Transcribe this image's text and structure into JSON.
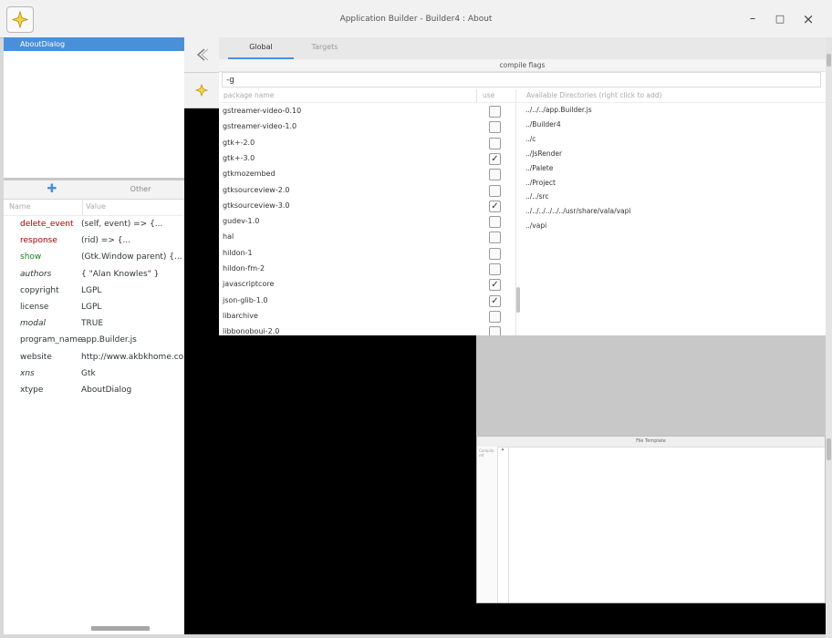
{
  "window": {
    "title": "Application Builder - Builder4 : About",
    "minimize_glyph": "–",
    "maximize_glyph": "□",
    "close_glyph": "×"
  },
  "tree": {
    "selected": "AboutDialog"
  },
  "left_tabs": {
    "other": "Other"
  },
  "props": {
    "headers": {
      "name": "Name",
      "value": "Value"
    },
    "rows": [
      {
        "name": "delete_event",
        "value": "(self, event) => {...",
        "kind": "event"
      },
      {
        "name": "response",
        "value": "(rid) => {...",
        "kind": "event"
      },
      {
        "name": "show",
        "value": "(Gtk.Window parent) {...",
        "kind": "show"
      },
      {
        "name": "authors",
        "value": "{ \"Alan Knowles\" }",
        "kind": "italic"
      },
      {
        "name": "copyright",
        "value": "LGPL",
        "kind": "plain"
      },
      {
        "name": "license",
        "value": "LGPL",
        "kind": "plain"
      },
      {
        "name": "modal",
        "value": "TRUE",
        "kind": "italic"
      },
      {
        "name": "program_name",
        "value": "app.Builder.js",
        "kind": "plain"
      },
      {
        "name": "website",
        "value": "http://www.akbkhome.com",
        "kind": "plain"
      },
      {
        "name": "xns",
        "value": "Gtk",
        "kind": "italic"
      },
      {
        "name": "xtype",
        "value": "AboutDialog",
        "kind": "plain"
      }
    ]
  },
  "tabs": {
    "global": "Global",
    "targets": "Targets"
  },
  "compile": {
    "label": "compile flags",
    "value": "-g"
  },
  "packages": {
    "headers": {
      "name": "package name",
      "use": "use"
    },
    "rows": [
      {
        "name": "gstreamer-video-0.10",
        "checked": false
      },
      {
        "name": "gstreamer-video-1.0",
        "checked": false
      },
      {
        "name": "gtk+-2.0",
        "checked": false
      },
      {
        "name": "gtk+-3.0",
        "checked": true
      },
      {
        "name": "gtkmozembed",
        "checked": false
      },
      {
        "name": "gtksourceview-2.0",
        "checked": false
      },
      {
        "name": "gtksourceview-3.0",
        "checked": true
      },
      {
        "name": "gudev-1.0",
        "checked": false
      },
      {
        "name": "hal",
        "checked": false
      },
      {
        "name": "hildon-1",
        "checked": false
      },
      {
        "name": "hildon-fm-2",
        "checked": false
      },
      {
        "name": "javascriptcore",
        "checked": true
      },
      {
        "name": "json-glib-1.0",
        "checked": true
      },
      {
        "name": "libarchive",
        "checked": false
      },
      {
        "name": "libbonoboui-2.0",
        "checked": false
      }
    ]
  },
  "directories": {
    "header": "Available Directories (right click to add)",
    "items": [
      "../../../app.Builder.js",
      "../Builder4",
      "../c",
      "../JsRender",
      "../Palete",
      "../Project",
      "../../src",
      "../../../../../../usr/share/vala/vapi",
      "../vapi"
    ]
  },
  "preview": {
    "title": "File Template",
    "left_label": "Compile ret"
  },
  "icons": {
    "app": "sparkle-icon",
    "back": "back-arrow-icon",
    "add": "plus-icon",
    "check": "✓"
  }
}
